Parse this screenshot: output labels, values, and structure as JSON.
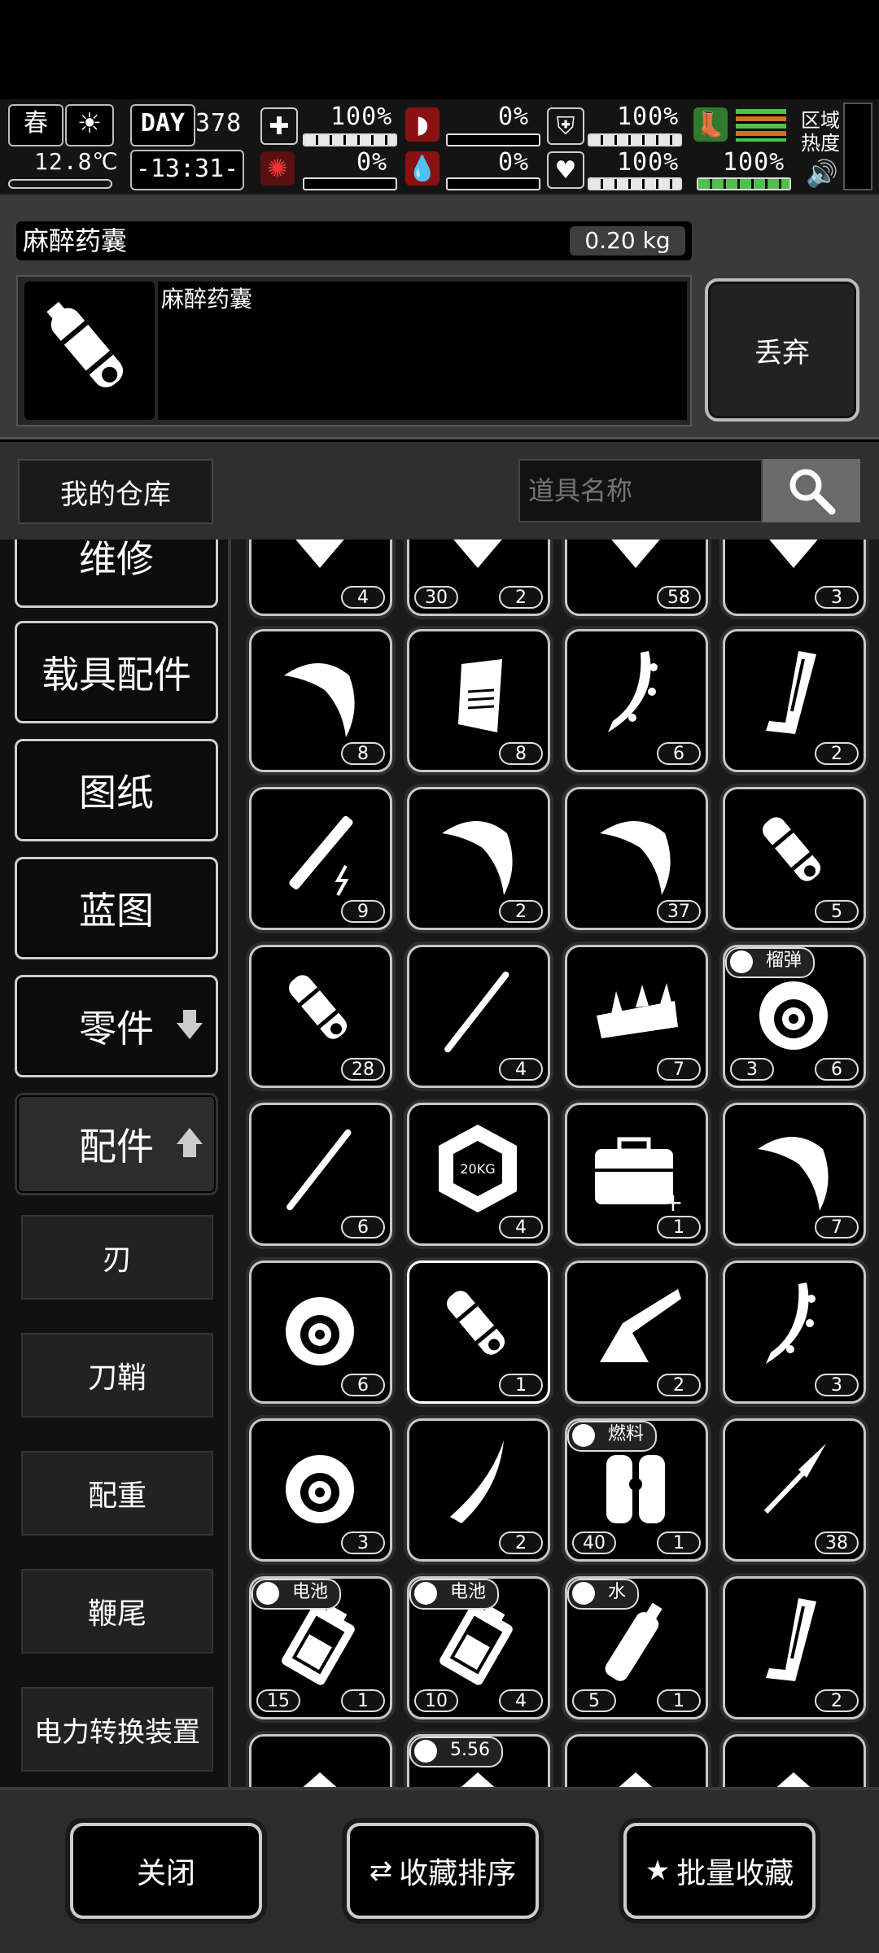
{
  "status": {
    "season": "春",
    "day_label": "DAY",
    "day_value": "378",
    "temperature": "12.8℃",
    "time": "-13:31-",
    "health": "100%",
    "hunger": "0%",
    "infection": "0%",
    "thirst": "0%",
    "armor": "100%",
    "mood": "100%",
    "stamina": "100%",
    "health_level": 1.0,
    "hunger_level": 0.0,
    "infection_level": 0.0,
    "thirst_level": 0.0,
    "armor_level": 1.0,
    "mood_level": 1.0,
    "stamina_level": 1.0,
    "zone_heat_label_1": "区域",
    "zone_heat_label_2": "热度"
  },
  "item": {
    "name": "麻醉药囊",
    "weight": "0.20 kg",
    "description": "麻醉药囊",
    "discard_label": "丢弃"
  },
  "warehouse": {
    "title": "我的仓库",
    "search_placeholder": "道具名称"
  },
  "categories": [
    {
      "label": "维修"
    },
    {
      "label": "载具配件"
    },
    {
      "label": "图纸"
    },
    {
      "label": "蓝图"
    },
    {
      "label": "零件",
      "arrow": "down"
    },
    {
      "label": "配件",
      "arrow": "up",
      "active": true
    }
  ],
  "subcategories": [
    "刃",
    "刀鞘",
    "配重",
    "鞭尾",
    "电力转换装置"
  ],
  "grid_rows": [
    [
      {
        "icon": "gear-part-icon",
        "count": "4"
      },
      {
        "icon": "battery-pack-icon",
        "count": "2",
        "count2": "30"
      },
      {
        "icon": "rod-part-icon",
        "count": "58"
      },
      {
        "icon": "shield-part-icon",
        "count": "3"
      }
    ],
    [
      {
        "icon": "hook-blade-icon",
        "count": "8"
      },
      {
        "icon": "grip-icon",
        "count": "8"
      },
      {
        "icon": "spiked-blade-icon",
        "count": "6"
      },
      {
        "icon": "magazine-icon",
        "count": "2"
      }
    ],
    [
      {
        "icon": "electric-rod-icon",
        "count": "9"
      },
      {
        "icon": "curved-blade-icon",
        "count": "2"
      },
      {
        "icon": "sickle-blade-icon",
        "count": "37"
      },
      {
        "icon": "capsule-icon",
        "count": "5"
      }
    ],
    [
      {
        "icon": "capsule-icon",
        "count": "28"
      },
      {
        "icon": "baton-icon",
        "count": "4"
      },
      {
        "icon": "spiked-weight-icon",
        "count": "7"
      },
      {
        "icon": "grenade-icon",
        "count": "6",
        "count2": "3",
        "tag": "榴弹"
      }
    ],
    [
      {
        "icon": "katana-blade-icon",
        "count": "6"
      },
      {
        "icon": "weight-20kg-icon",
        "count": "4"
      },
      {
        "icon": "toolbox-icon",
        "count": "1"
      },
      {
        "icon": "hook-blade-icon",
        "count": "7"
      }
    ],
    [
      {
        "icon": "turbine-icon",
        "count": "6"
      },
      {
        "icon": "capsule-icon",
        "count": "1",
        "selected": true
      },
      {
        "icon": "stock-icon",
        "count": "2"
      },
      {
        "icon": "saw-blade-icon",
        "count": "3"
      }
    ],
    [
      {
        "icon": "turbine-icon",
        "count": "3"
      },
      {
        "icon": "machete-blade-icon",
        "count": "2"
      },
      {
        "icon": "fuel-tank-icon",
        "count": "1",
        "count2": "40",
        "tag": "燃料"
      },
      {
        "icon": "spear-tip-icon",
        "count": "38"
      }
    ],
    [
      {
        "icon": "battery-cell-icon",
        "count": "1",
        "count2": "15",
        "tag": "电池"
      },
      {
        "icon": "battery-cell-icon",
        "count": "4",
        "count2": "10",
        "tag": "电池"
      },
      {
        "icon": "water-bottle-icon",
        "count": "1",
        "count2": "5",
        "tag": "水"
      },
      {
        "icon": "magazine-icon",
        "count": "2"
      }
    ],
    [
      {
        "icon": "part-icon",
        "count": ""
      },
      {
        "icon": "ammo-icon",
        "count": "",
        "tag": "5.56"
      },
      {
        "icon": "blade-icon",
        "count": ""
      },
      {
        "icon": "nozzle-icon",
        "count": ""
      }
    ]
  ],
  "bottom": {
    "close": "关闭",
    "sort": "收藏排序",
    "batch": "批量收藏"
  }
}
